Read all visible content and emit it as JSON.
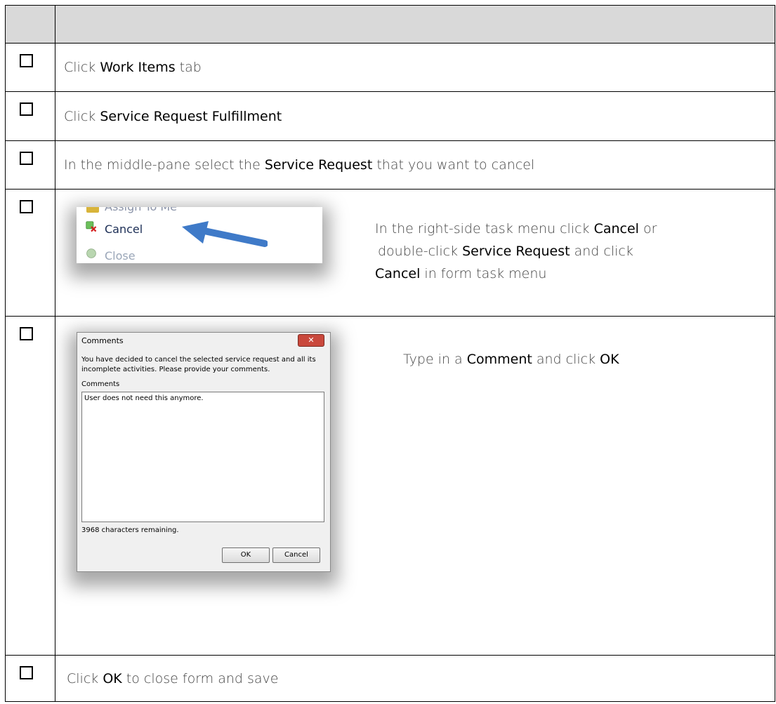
{
  "steps": [
    {
      "pre": "Click ",
      "bold": "Work Items",
      "post": " tab"
    },
    {
      "pre": "Click ",
      "bold": "Service Request Fulfillment",
      "post": ""
    },
    {
      "pre": "In the middle-pane select the ",
      "bold": "Service Request",
      "post": " that you want to cancel"
    },
    {
      "menu_items": [
        "Assign To Me",
        "Cancel",
        "Close"
      ],
      "lines": [
        {
          "pre": "In the right-side task menu click ",
          "bold": "Cancel",
          "post": " or"
        },
        {
          "pre": "double-click ",
          "bold": "Service Request",
          "post": " and click"
        },
        {
          "pre": "",
          "bold": "Cancel",
          "post": " in form task menu"
        }
      ]
    },
    {
      "dialog": {
        "title": "Comments",
        "message": "You have decided to cancel the selected service request and all its incomplete activities. Please provide your comments.",
        "comments_label": "Comments",
        "comment_value": "User does not need this anymore.",
        "remaining": "3968 characters remaining.",
        "ok_label": "OK",
        "cancel_label": "Cancel"
      },
      "text": {
        "pre": "Type in a ",
        "bold": "Comment",
        "mid": " and click ",
        "bold2": "OK"
      }
    },
    {
      "pre": "Click ",
      "bold": "OK",
      "post": " to close form and save"
    }
  ],
  "colors": {
    "header_bg": "#d9d9d9",
    "arrow": "#3f7ac8",
    "close_button": "#c9483c"
  }
}
